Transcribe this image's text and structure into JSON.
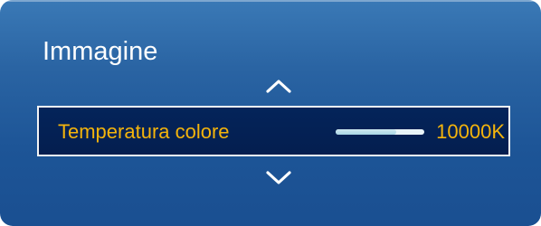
{
  "menu": {
    "title": "Immagine",
    "nav_up_icon": "chevron-up-icon",
    "nav_down_icon": "chevron-down-icon"
  },
  "selected_item": {
    "label": "Temperatura colore",
    "value": "10000K",
    "slider_level": 0.68
  },
  "colors": {
    "background": "#1d5597",
    "selected_row": "#04245a",
    "highlight_text": "#f4b40c",
    "title_text": "#ffffff"
  }
}
